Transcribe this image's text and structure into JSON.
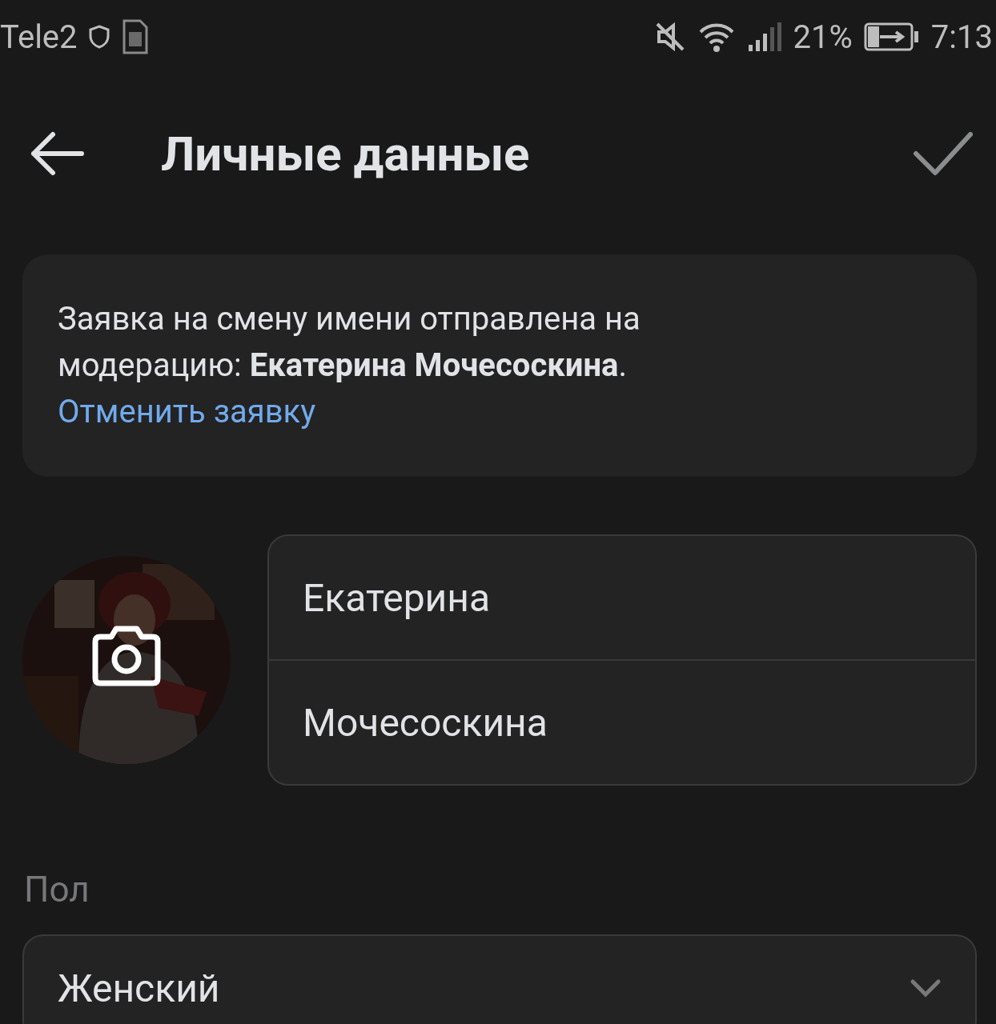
{
  "status_bar": {
    "carrier": "Tele2",
    "battery": "21%",
    "time": "7:13"
  },
  "header": {
    "title": "Личные данные"
  },
  "notice": {
    "text": "Заявка на смену имени отправлена на модерацию: **Екатерина Мочесоскина**.",
    "link": "Отменить заявку"
  },
  "name_fields": [
    {
      "value": "Екатерина"
    },
    {
      "value": "Мочесоскина"
    }
  ],
  "gender": {
    "label": "Пол",
    "value": "Женский"
  }
}
